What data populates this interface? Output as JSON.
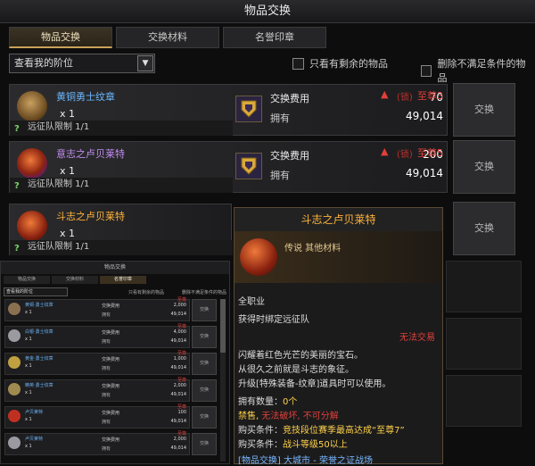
{
  "window": {
    "title": "物品交换"
  },
  "tabs": [
    {
      "label": "物品交换",
      "active": true
    },
    {
      "label": "交换材料",
      "active": false
    },
    {
      "label": "名誉印章",
      "active": false
    }
  ],
  "filter": {
    "tier_select": "查看我的阶位",
    "remaining_only": "只看有剩余的物品",
    "hide_unmet": "删除不满足条件的物品"
  },
  "items": [
    {
      "name": "黄铜勇士纹章",
      "name_color": "#6ab7ff",
      "qty": "x 1",
      "limit": "远征队限制 1/1",
      "cost_label": "交换费用",
      "cost": "70",
      "have_label": "拥有",
      "have": "49,014",
      "rank": "至尊3",
      "lock": "(锁)",
      "button": "交换"
    },
    {
      "name": "意志之卢贝莱特",
      "name_color": "#c08cf0",
      "qty": "x 1",
      "limit": "远征队限制 1/1",
      "cost_label": "交换费用",
      "cost": "200",
      "have_label": "拥有",
      "have": "49,014",
      "rank": "至尊5",
      "lock": "(锁)",
      "button": "交换"
    },
    {
      "name": "斗志之卢贝莱特",
      "name_color": "#ffb33a",
      "qty": "x 1",
      "limit": "远征队限制 1/1",
      "button": "交换"
    }
  ],
  "tooltip": {
    "title": "斗志之卢贝莱特",
    "grade": "传说 其他材料",
    "class": "全职业",
    "bind": "获得时绑定远征队",
    "no_trade": "无法交易",
    "desc1": "闪耀着红色光芒的美丽的宝石。",
    "desc2": "从很久之前就是斗志的象征。",
    "desc3": "升级[特殊装备-纹章]道具时可以使用。",
    "owned": "拥有数量：",
    "owned_value": "0个",
    "restrict1": "禁售,",
    "restrict2": "无法破坏,",
    "restrict3": "不可分解",
    "cond1_label": "购买条件：",
    "cond1": "竞技段位赛季最高达成“至尊7”",
    "cond2_label": "购买条件：",
    "cond2": "战斗等级50以上",
    "source": "[物品交换] 大城市 - 荣誉之证战场"
  },
  "mini": {
    "title": "物品交换",
    "tabs": [
      "物品交换",
      "交换材料",
      "名誉印章"
    ],
    "select": "查看我的阶位",
    "chk1": "只看有剩余的物品",
    "chk2": "删除不满足条件的物品",
    "rows": [
      {
        "name": "黄铜·勇士纹章",
        "qty": "x 1",
        "cost_label": "交换费用",
        "cost": "2,000",
        "have_label": "拥有",
        "have": "49,014",
        "rank": "至尊",
        "button": "交换"
      },
      {
        "name": "白银·勇士纹章",
        "qty": "x 1",
        "cost_label": "交换费用",
        "cost": "4,000",
        "have_label": "拥有",
        "have": "49,014",
        "rank": "至尊",
        "button": "交换"
      },
      {
        "name": "黄金·勇士纹章",
        "qty": "x 1",
        "cost_label": "交换费用",
        "cost": "1,000",
        "have_label": "拥有",
        "have": "49,014",
        "rank": "至尊",
        "button": "交换"
      },
      {
        "name": "精英·勇士纹章",
        "qty": "x 1",
        "cost_label": "交换费用",
        "cost": "2,000",
        "have_label": "拥有",
        "have": "49,014",
        "rank": "至尊",
        "button": "交换"
      },
      {
        "name": "卢贝莱特",
        "qty": "x 1",
        "cost_label": "交换费用",
        "cost": "100",
        "have_label": "拥有",
        "have": "49,014",
        "rank": "至尊",
        "button": "交换"
      },
      {
        "name": "卢贝莱特",
        "qty": "x 1",
        "cost_label": "交换费用",
        "cost": "2,000",
        "have_label": "拥有",
        "have": "49,014",
        "rank": "至尊",
        "button": "交换"
      }
    ]
  }
}
